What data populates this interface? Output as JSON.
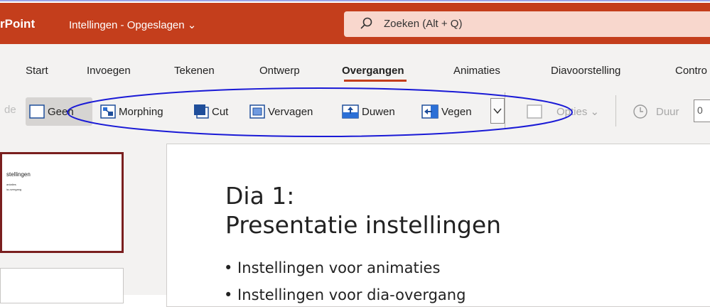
{
  "titlebar": {
    "app_name": "rPoint",
    "doc_title": "Intellingen - Opgeslagen ⌄",
    "search_placeholder": "Zoeken (Alt + Q)"
  },
  "tabs": [
    {
      "label": "Start"
    },
    {
      "label": "Invoegen"
    },
    {
      "label": "Tekenen"
    },
    {
      "label": "Ontwerp"
    },
    {
      "label": "Overgangen",
      "active": true
    },
    {
      "label": "Animaties"
    },
    {
      "label": "Diavoorstelling"
    },
    {
      "label": "Contro"
    }
  ],
  "ribbon": {
    "clipped": "de",
    "transitions": [
      {
        "label": "Geen",
        "icon": "none-transition-icon"
      },
      {
        "label": "Morphing",
        "icon": "morph-transition-icon"
      },
      {
        "label": "Cut",
        "icon": "cut-transition-icon"
      },
      {
        "label": "Vervagen",
        "icon": "fade-transition-icon"
      },
      {
        "label": "Duwen",
        "icon": "push-transition-icon"
      },
      {
        "label": "Vegen",
        "icon": "wipe-transition-icon"
      }
    ],
    "options_label": "Opties ⌄",
    "duration_label": "Duur",
    "duration_value": "0"
  },
  "thumbnail": {
    "title": "stellingen",
    "bullet1": "aniaties",
    "bullet2": "ia-overgang"
  },
  "slide": {
    "title_line1": "Dia 1:",
    "title_line2": "Presentatie instellingen",
    "bullets": [
      "• Instellingen voor animaties",
      "• Instellingen voor dia-overgang"
    ]
  },
  "colors": {
    "brand": "#c43e1c",
    "annotation": "#1a1ad6",
    "thumb_border": "#7a1f1f"
  }
}
